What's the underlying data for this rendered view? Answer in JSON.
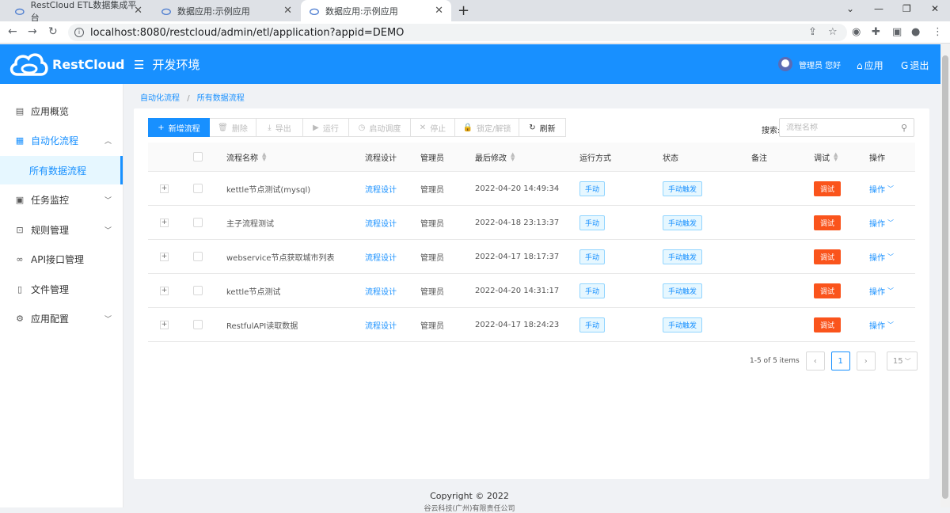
{
  "browser": {
    "tabs": [
      {
        "title": "RestCloud ETL数据集成平台",
        "active": false
      },
      {
        "title": "数据应用:示例应用",
        "active": false
      },
      {
        "title": "数据应用:示例应用",
        "active": true
      }
    ],
    "url": "localhost:8080/restcloud/admin/etl/application?appid=DEMO"
  },
  "header": {
    "logo_text": "RestCloud",
    "env_label": "开发环境",
    "user_greeting": "管理员 您好",
    "app_link": "应用",
    "logout_link": "退出"
  },
  "sidebar": {
    "items": [
      {
        "label": "应用概览",
        "icon": "overview-icon"
      },
      {
        "label": "自动化流程",
        "icon": "grid-icon"
      },
      {
        "label": "所有数据流程",
        "icon": ""
      },
      {
        "label": "任务监控",
        "icon": "monitor-icon"
      },
      {
        "label": "规则管理",
        "icon": "rules-icon"
      },
      {
        "label": "API接口管理",
        "icon": "link-icon"
      },
      {
        "label": "文件管理",
        "icon": "file-icon"
      },
      {
        "label": "应用配置",
        "icon": "gear-icon"
      }
    ]
  },
  "breadcrumb": {
    "parent": "自动化流程",
    "current": "所有数据流程"
  },
  "toolbar": {
    "new": "新增流程",
    "delete": "删除",
    "export": "导出",
    "run": "运行",
    "schedule": "启动调度",
    "stop": "停止",
    "lock": "锁定/解锁",
    "refresh": "刷新"
  },
  "search": {
    "label": "搜索:",
    "placeholder": "流程名称"
  },
  "table": {
    "headers": {
      "name": "流程名称",
      "design": "流程设计",
      "admin": "管理员",
      "modified": "最后修改",
      "run_mode": "运行方式",
      "status": "状态",
      "note": "备注",
      "debug": "调试",
      "ops": "操作"
    },
    "rows": [
      {
        "name": "kettle节点测试(mysql)",
        "design": "流程设计",
        "admin": "管理员",
        "modified": "2022-04-20 14:49:34",
        "run_mode": "手动",
        "status": "手动触发",
        "debug": "调试",
        "ops": "操作"
      },
      {
        "name": "主子流程测试",
        "design": "流程设计",
        "admin": "管理员",
        "modified": "2022-04-18 23:13:37",
        "run_mode": "手动",
        "status": "手动触发",
        "debug": "调试",
        "ops": "操作"
      },
      {
        "name": "webservice节点获取城市列表",
        "design": "流程设计",
        "admin": "管理员",
        "modified": "2022-04-17 18:17:37",
        "run_mode": "手动",
        "status": "手动触发",
        "debug": "调试",
        "ops": "操作"
      },
      {
        "name": "kettle节点测试",
        "design": "流程设计",
        "admin": "管理员",
        "modified": "2022-04-20 14:31:17",
        "run_mode": "手动",
        "status": "手动触发",
        "debug": "调试",
        "ops": "操作"
      },
      {
        "name": "RestfulAPI读取数据",
        "design": "流程设计",
        "admin": "管理员",
        "modified": "2022-04-17 18:24:23",
        "run_mode": "手动",
        "status": "手动触发",
        "debug": "调试",
        "ops": "操作"
      }
    ]
  },
  "pagination": {
    "summary": "1-5 of 5 items",
    "current": "1",
    "page_size": "15"
  },
  "footer": {
    "copyright": "Copyright © 2022",
    "company": "谷云科技(广州)有限责任公司"
  },
  "colors": {
    "primary": "#1890ff",
    "debug": "#fa541c"
  }
}
